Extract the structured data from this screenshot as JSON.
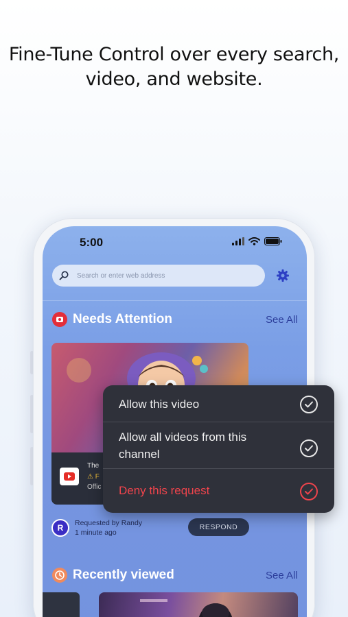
{
  "headline": "Fine-Tune Control over every search, video, and website.",
  "status_bar": {
    "time": "5:00"
  },
  "search": {
    "placeholder": "Search or enter web address"
  },
  "needs_attention": {
    "title": "Needs Attention",
    "see_all": "See All",
    "card": {
      "title_fragment": "The",
      "warning_fragment": "⚠ F",
      "channel_fragment": "Offic"
    },
    "requested_by": "Requested by Randy",
    "time_ago": "1 minute ago",
    "avatar_initial": "R",
    "respond_label": "RESPOND"
  },
  "recently_viewed": {
    "title": "Recently viewed",
    "see_all": "See All"
  },
  "popup_menu": {
    "items": [
      {
        "label": "Allow this video",
        "color": "#f1f1f1"
      },
      {
        "label": "Allow all videos from this channel",
        "color": "#f1f1f1"
      },
      {
        "label": "Deny this request",
        "color": "#f0444c"
      }
    ]
  },
  "colors": {
    "accent": "#2d3f9c",
    "needs_attention_icon": "#e32e3a",
    "recently_viewed_icon": "#f08a5d",
    "deny": "#f0444c"
  }
}
